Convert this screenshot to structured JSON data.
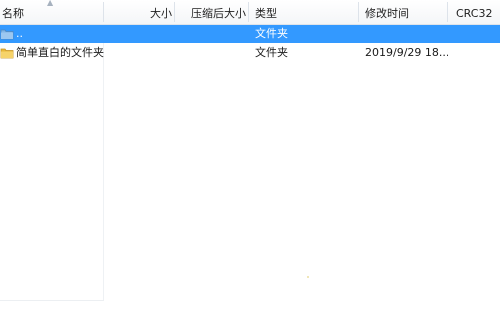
{
  "columns": {
    "name": "名称",
    "size": "大小",
    "packed_size": "压缩后大小",
    "type": "类型",
    "modified": "修改时间",
    "crc": "CRC32"
  },
  "rows": [
    {
      "name": "..",
      "type": "文件夹",
      "modified": "",
      "selected": true,
      "icon": "folder-up-icon"
    },
    {
      "name": "简单直白的文件夹",
      "type": "文件夹",
      "modified": "2019/9/29 18...",
      "selected": false,
      "icon": "folder-icon"
    }
  ],
  "colors": {
    "selection": "#3399ff",
    "folder": "#f2c64d"
  }
}
